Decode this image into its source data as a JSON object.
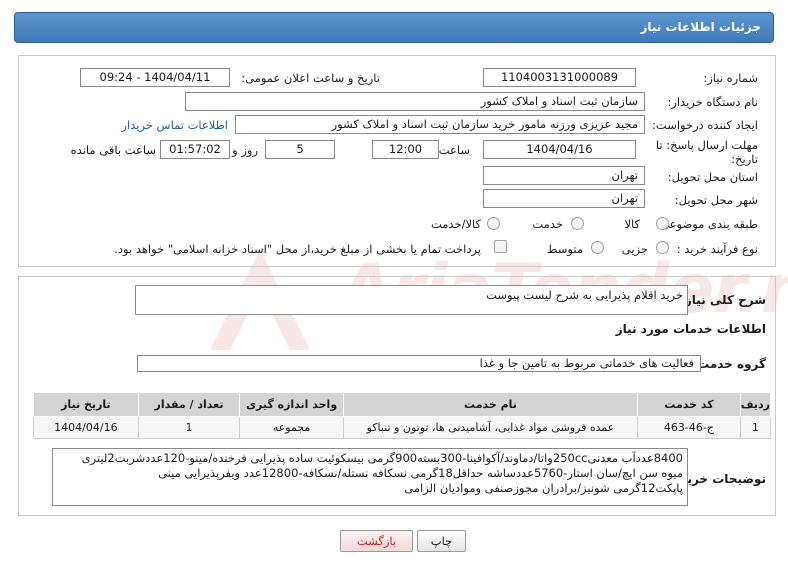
{
  "header": {
    "title": "جزئیات اطلاعات نیاز"
  },
  "form": {
    "need_number_label": "شماره نیاز:",
    "need_number": "1104003131000089",
    "announce_label": "تاریخ و ساعت اعلان عمومی:",
    "announce_value": "1404/04/11 - 09:24",
    "buyer_org_label": "نام دستگاه خریدار:",
    "buyer_org": "سازمان ثبت اسناد و املاک کشور",
    "creator_label": "ایجاد کننده درخواست:",
    "creator": "مجید عزیزی ورزنه مامور خرید سازمان ثبت اسناد و املاک کشور",
    "contact_link": "اطلاعات تماس خریدار",
    "deadline_label_1": "مهلت ارسال پاسخ: تا",
    "deadline_label_2": "تاریخ:",
    "deadline_date": "1404/04/16",
    "time_label": "ساعت",
    "deadline_time": "12:00",
    "days_value": "5",
    "days_label": "روز و",
    "remaining_time": "01:57:02",
    "remaining_label": "ساعت باقی مانده",
    "province_label": "استان محل تحویل:",
    "province": "تهران",
    "city_label": "شهر محل تحویل:",
    "city": "تهران",
    "category_label": "طبقه بندی موضوعی:",
    "category_options": [
      "کالا",
      "خدمت",
      "کالا/خدمت"
    ],
    "process_label": "نوع فرآیند خرید :",
    "process_options": [
      "جزیی",
      "متوسط"
    ],
    "payment_note": "پرداخت تمام یا بخشی از مبلغ خرید،از محل \"اسناد خزانه اسلامی\" خواهد بود."
  },
  "summary": {
    "label": "شرح کلی نیاز:",
    "value": "خرید اقلام پذیرایی به شرح لیست پیوست"
  },
  "services": {
    "section_title": "اطلاعات خدمات مورد نیاز",
    "group_label": "گروه خدمت:",
    "group_value": "فعالیت های خدماتی مربوط به تامین جا و غذا",
    "columns": [
      "ردیف",
      "کد خدمت",
      "نام خدمت",
      "واحد اندازه گیری",
      "تعداد / مقدار",
      "تاریخ نیاز"
    ],
    "rows": [
      [
        "1",
        "ج-46-463",
        "عمده فروشی مواد غذایی، آشامیدنی ها، توتون و تنباکو",
        "مجموعه",
        "1",
        "1404/04/16"
      ]
    ]
  },
  "buyer_notes": {
    "label": "توضیحات خریدار:",
    "lines": [
      "8400عددآب معدنی250ccواتا/دماوند/آکوافینا-300بسته900گرمی بیسکوئیت ساده پذیرایی فرخنده/مینو-120عددشربت2لیتری",
      "میوه سن ایچ/سان استار-5760عددساشه حداقل18گرمی نسکافه نستله/نسکافه-12800عدد ویفرپذیرایی مینی",
      "پاپکت12گرمی شونیز/برادران مجوزصنفی وموادیان الزامی"
    ]
  },
  "buttons": {
    "print": "چاپ",
    "back": "بازگشت"
  },
  "watermark": "AriaTender.neT",
  "colors": {
    "header": "#4a86c5",
    "link": "#1a5fb4",
    "back_button_text": "#cc2222"
  }
}
